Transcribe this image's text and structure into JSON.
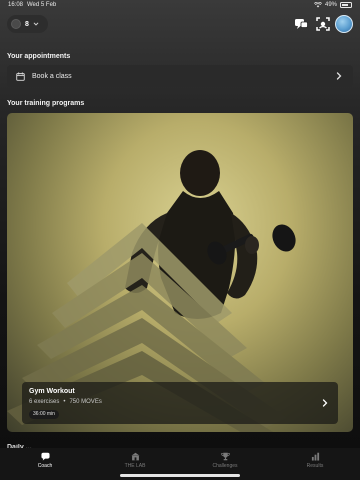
{
  "status_bar": {
    "time": "16:08",
    "date": "Wed 5 Feb",
    "battery": "49%"
  },
  "top_bar": {
    "moves_value": "8",
    "icons": [
      "moves-ring-icon",
      "chevron-down-icon",
      "chat-icon",
      "scan-icon",
      "avatar"
    ]
  },
  "appointments": {
    "title": "Your appointments",
    "book_label": "Book a class"
  },
  "programs": {
    "title": "Your training programs",
    "card": {
      "title": "Gym Workout",
      "exercises": "6 exercises",
      "separator": "•",
      "moves": "750 MOVEs",
      "duration": "36:00 min"
    }
  },
  "next_section_peek": "Daily ...",
  "bottom_nav": {
    "items": [
      {
        "label": "Coach",
        "icon": "coach-chat-icon",
        "active": true
      },
      {
        "label": "THE LAB",
        "icon": "lab-building-icon",
        "active": false
      },
      {
        "label": "Challenges",
        "icon": "trophy-icon",
        "active": false
      },
      {
        "label": "Results",
        "icon": "bar-chart-icon",
        "active": false
      }
    ]
  },
  "colors": {
    "background": "#0e0e0e",
    "row_bg": "#2a2a2a",
    "card_yellow": "#d9d191",
    "nav_active": "#ffffff",
    "nav_inactive": "#7a7a7a"
  }
}
